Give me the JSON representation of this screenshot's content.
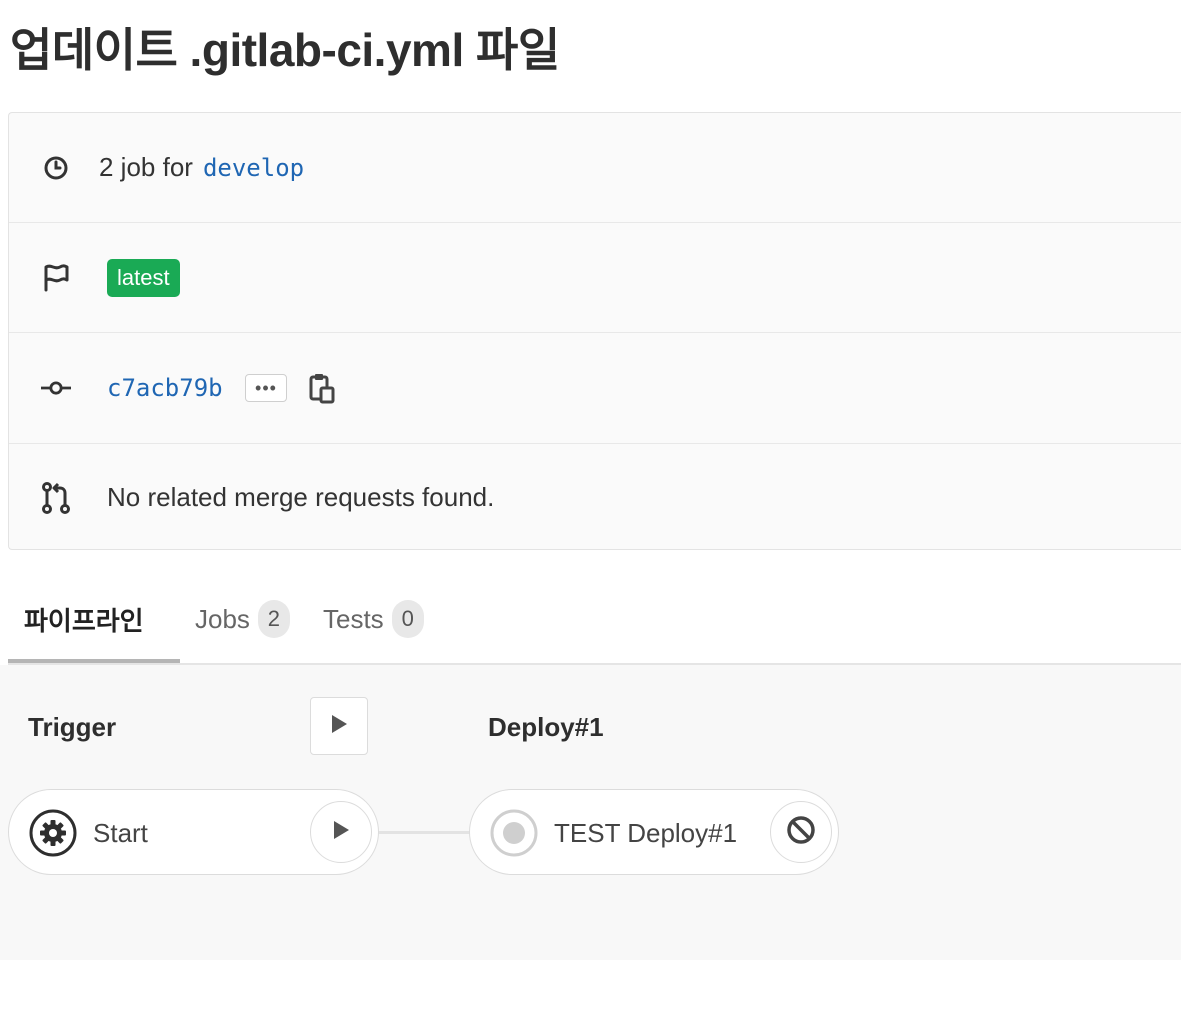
{
  "page": {
    "title": "업데이트 .gitlab-ci.yml 파일"
  },
  "info": {
    "jobs_text": "2 job for",
    "branch": "develop",
    "badge": "latest",
    "commit_sha": "c7acb79b",
    "ellipsis": "•••",
    "merge_requests_text": "No related merge requests found."
  },
  "tabs": [
    {
      "label": "파이프라인",
      "active": true
    },
    {
      "label": "Jobs",
      "count": "2"
    },
    {
      "label": "Tests",
      "count": "0"
    }
  ],
  "pipeline": {
    "stages": [
      {
        "title": "Trigger",
        "jobs": [
          {
            "name": "Start",
            "status_icon": "gear-icon",
            "action_icon": "play-icon"
          }
        ]
      },
      {
        "title": "Deploy#1",
        "jobs": [
          {
            "name": "TEST Deploy#1",
            "status_icon": "skipped-icon",
            "action_icon": "cancel-icon"
          }
        ]
      }
    ]
  },
  "colors": {
    "link": "#1f66b3",
    "badge_green": "#1aaa55",
    "pipeline_bg": "#f8f8f8"
  }
}
